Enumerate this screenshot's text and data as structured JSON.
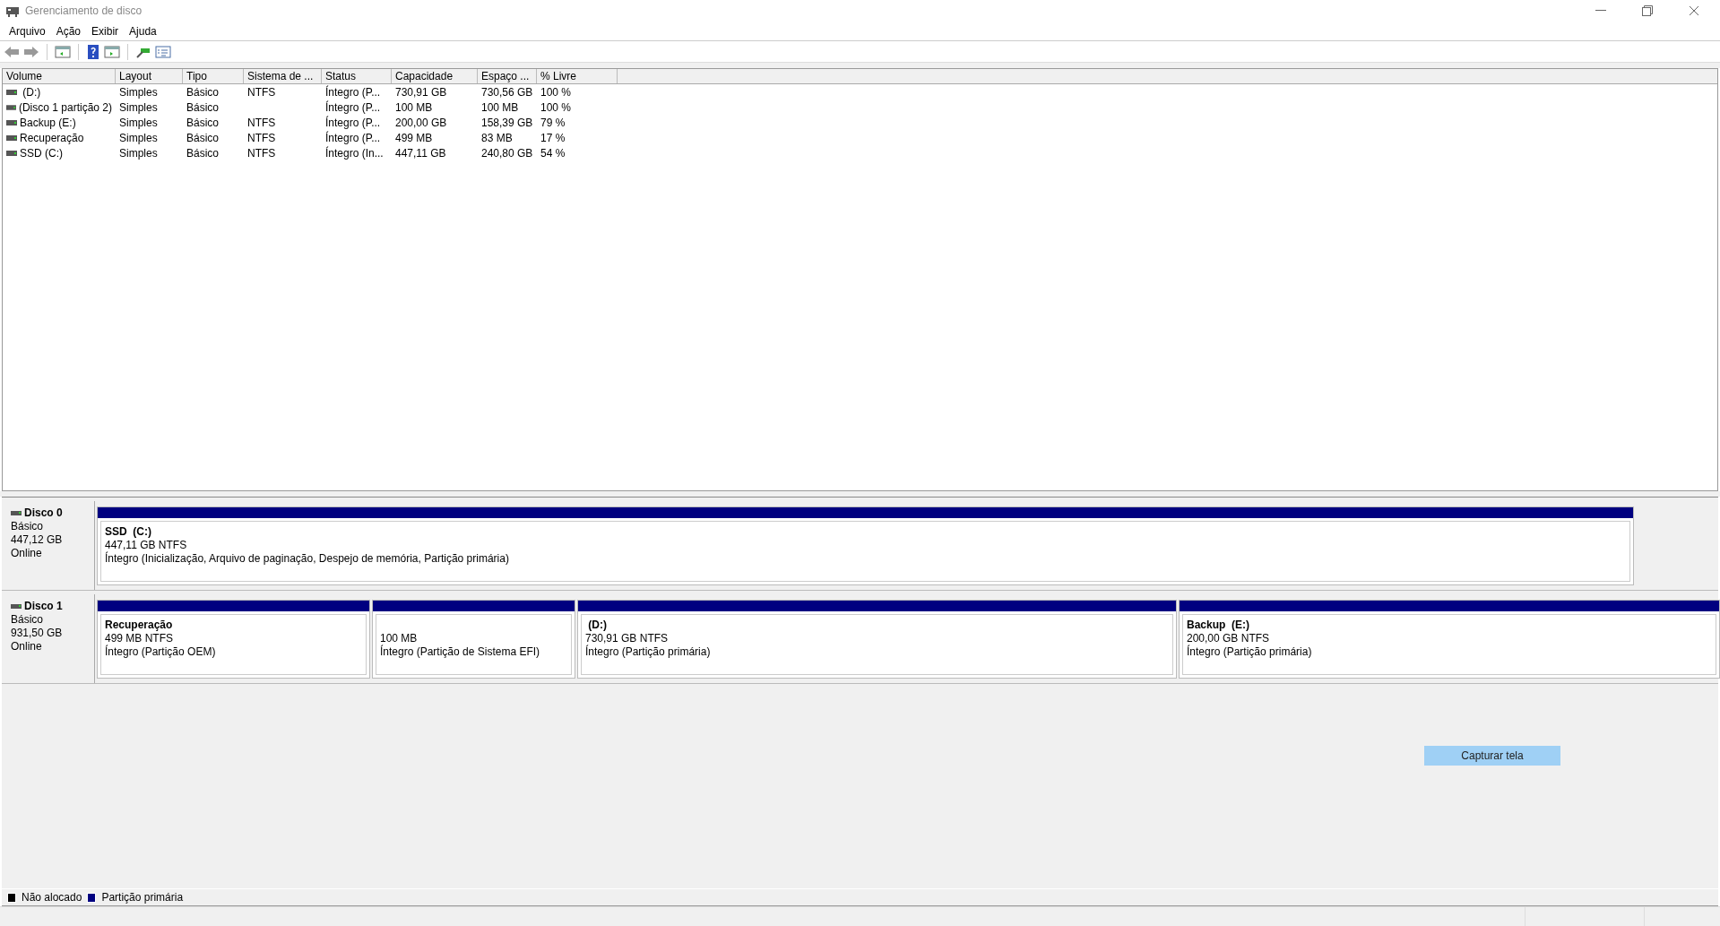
{
  "window": {
    "title": "Gerenciamento de disco"
  },
  "menu": [
    "Arquivo",
    "Ação",
    "Exibir",
    "Ajuda"
  ],
  "table": {
    "columns": [
      "Volume",
      "Layout",
      "Tipo",
      "Sistema de ...",
      "Status",
      "Capacidade",
      "Espaço ...",
      "% Livre"
    ],
    "rows": [
      {
        "volume": " (D:)",
        "layout": "Simples",
        "type": "Básico",
        "file_system": "NTFS",
        "status": "Íntegro (P...",
        "capacity": "730,91 GB",
        "free_space": "730,56 GB",
        "percent_free": "100 %"
      },
      {
        "volume": "(Disco 1 partição 2)",
        "layout": "Simples",
        "type": "Básico",
        "status": "Íntegro (P...",
        "capacity": "100 MB",
        "free_space": "100 MB",
        "percent_free": "100 %"
      },
      {
        "volume": "Backup (E:)",
        "layout": "Simples",
        "type": "Básico",
        "file_system": "NTFS",
        "status": "Íntegro (P...",
        "capacity": "200,00 GB",
        "free_space": "158,39 GB",
        "percent_free": "79 %"
      },
      {
        "volume": "Recuperação",
        "layout": "Simples",
        "type": "Básico",
        "file_system": "NTFS",
        "status": "Íntegro (P...",
        "capacity": "499 MB",
        "free_space": "83 MB",
        "percent_free": "17 %"
      },
      {
        "volume": "SSD (C:)",
        "layout": "Simples",
        "type": "Básico",
        "file_system": "NTFS",
        "status": "Íntegro (In...",
        "capacity": "447,11 GB",
        "free_space": "240,80 GB",
        "percent_free": "54 %"
      }
    ]
  },
  "disks": [
    {
      "name": "Disco 0",
      "type": "Básico",
      "size": "447,12 GB",
      "state": "Online",
      "partitions": [
        {
          "name": "SSD  (C:)",
          "size": "447,11 GB NTFS",
          "status": "Íntegro (Inicialização, Arquivo de paginação, Despejo de memória, Partição primária)"
        }
      ]
    },
    {
      "name": "Disco 1",
      "type": "Básico",
      "size": "931,50 GB",
      "state": "Online",
      "partitions": [
        {
          "name": "Recuperação",
          "size": "499 MB NTFS",
          "status": "Íntegro (Partição OEM)"
        },
        {
          "size": "100 MB",
          "status": "Íntegro (Partição de Sistema EFI)"
        },
        {
          "name": " (D:)",
          "size": "730,91 GB NTFS",
          "status": "Íntegro (Partição primária)"
        },
        {
          "name": "Backup  (E:)",
          "size": "200,00 GB NTFS",
          "status": "Íntegro (Partição primária)"
        }
      ]
    }
  ],
  "capture_button": "Capturar tela",
  "legend": [
    {
      "label": "Não alocado",
      "color": "#000000"
    },
    {
      "label": "Partição primária",
      "color": "#000080"
    }
  ]
}
